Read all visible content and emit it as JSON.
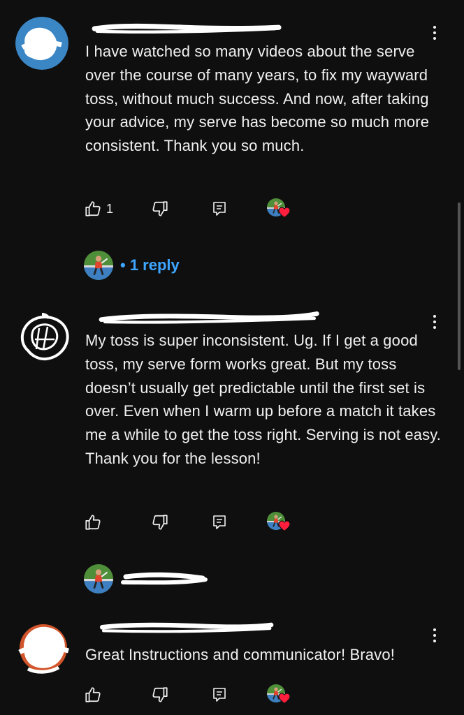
{
  "comments": [
    {
      "text": "I have watched so many videos about the serve over the course of many years, to fix my wayward toss, without much success. And now, after taking your advice, my serve has become so much more consistent. Thank you so much.",
      "like_count": "1",
      "reply": {
        "label": "1 reply"
      }
    },
    {
      "text": "My toss is super inconsistent. Ug. If I get a good toss, my serve form works great. But my toss doesn’t usually get predictable until the first set is over. Even when I warm up before a match it takes me a while to get the toss right. Serving is not easy. Thank you for the lesson!",
      "like_count": ""
    },
    {
      "text": "Great Instructions and communicator! Bravo!",
      "like_count": ""
    }
  ],
  "icons": {
    "like": "thumbs-up-icon",
    "dislike": "thumbs-down-icon",
    "reply": "comment-icon",
    "heart": "heart-icon",
    "menu": "more-vertical-icon"
  },
  "colors": {
    "background": "#0f0f0f",
    "text": "#f1f1f1",
    "link": "#3ea6ff",
    "heart": "#ff1f3d"
  }
}
